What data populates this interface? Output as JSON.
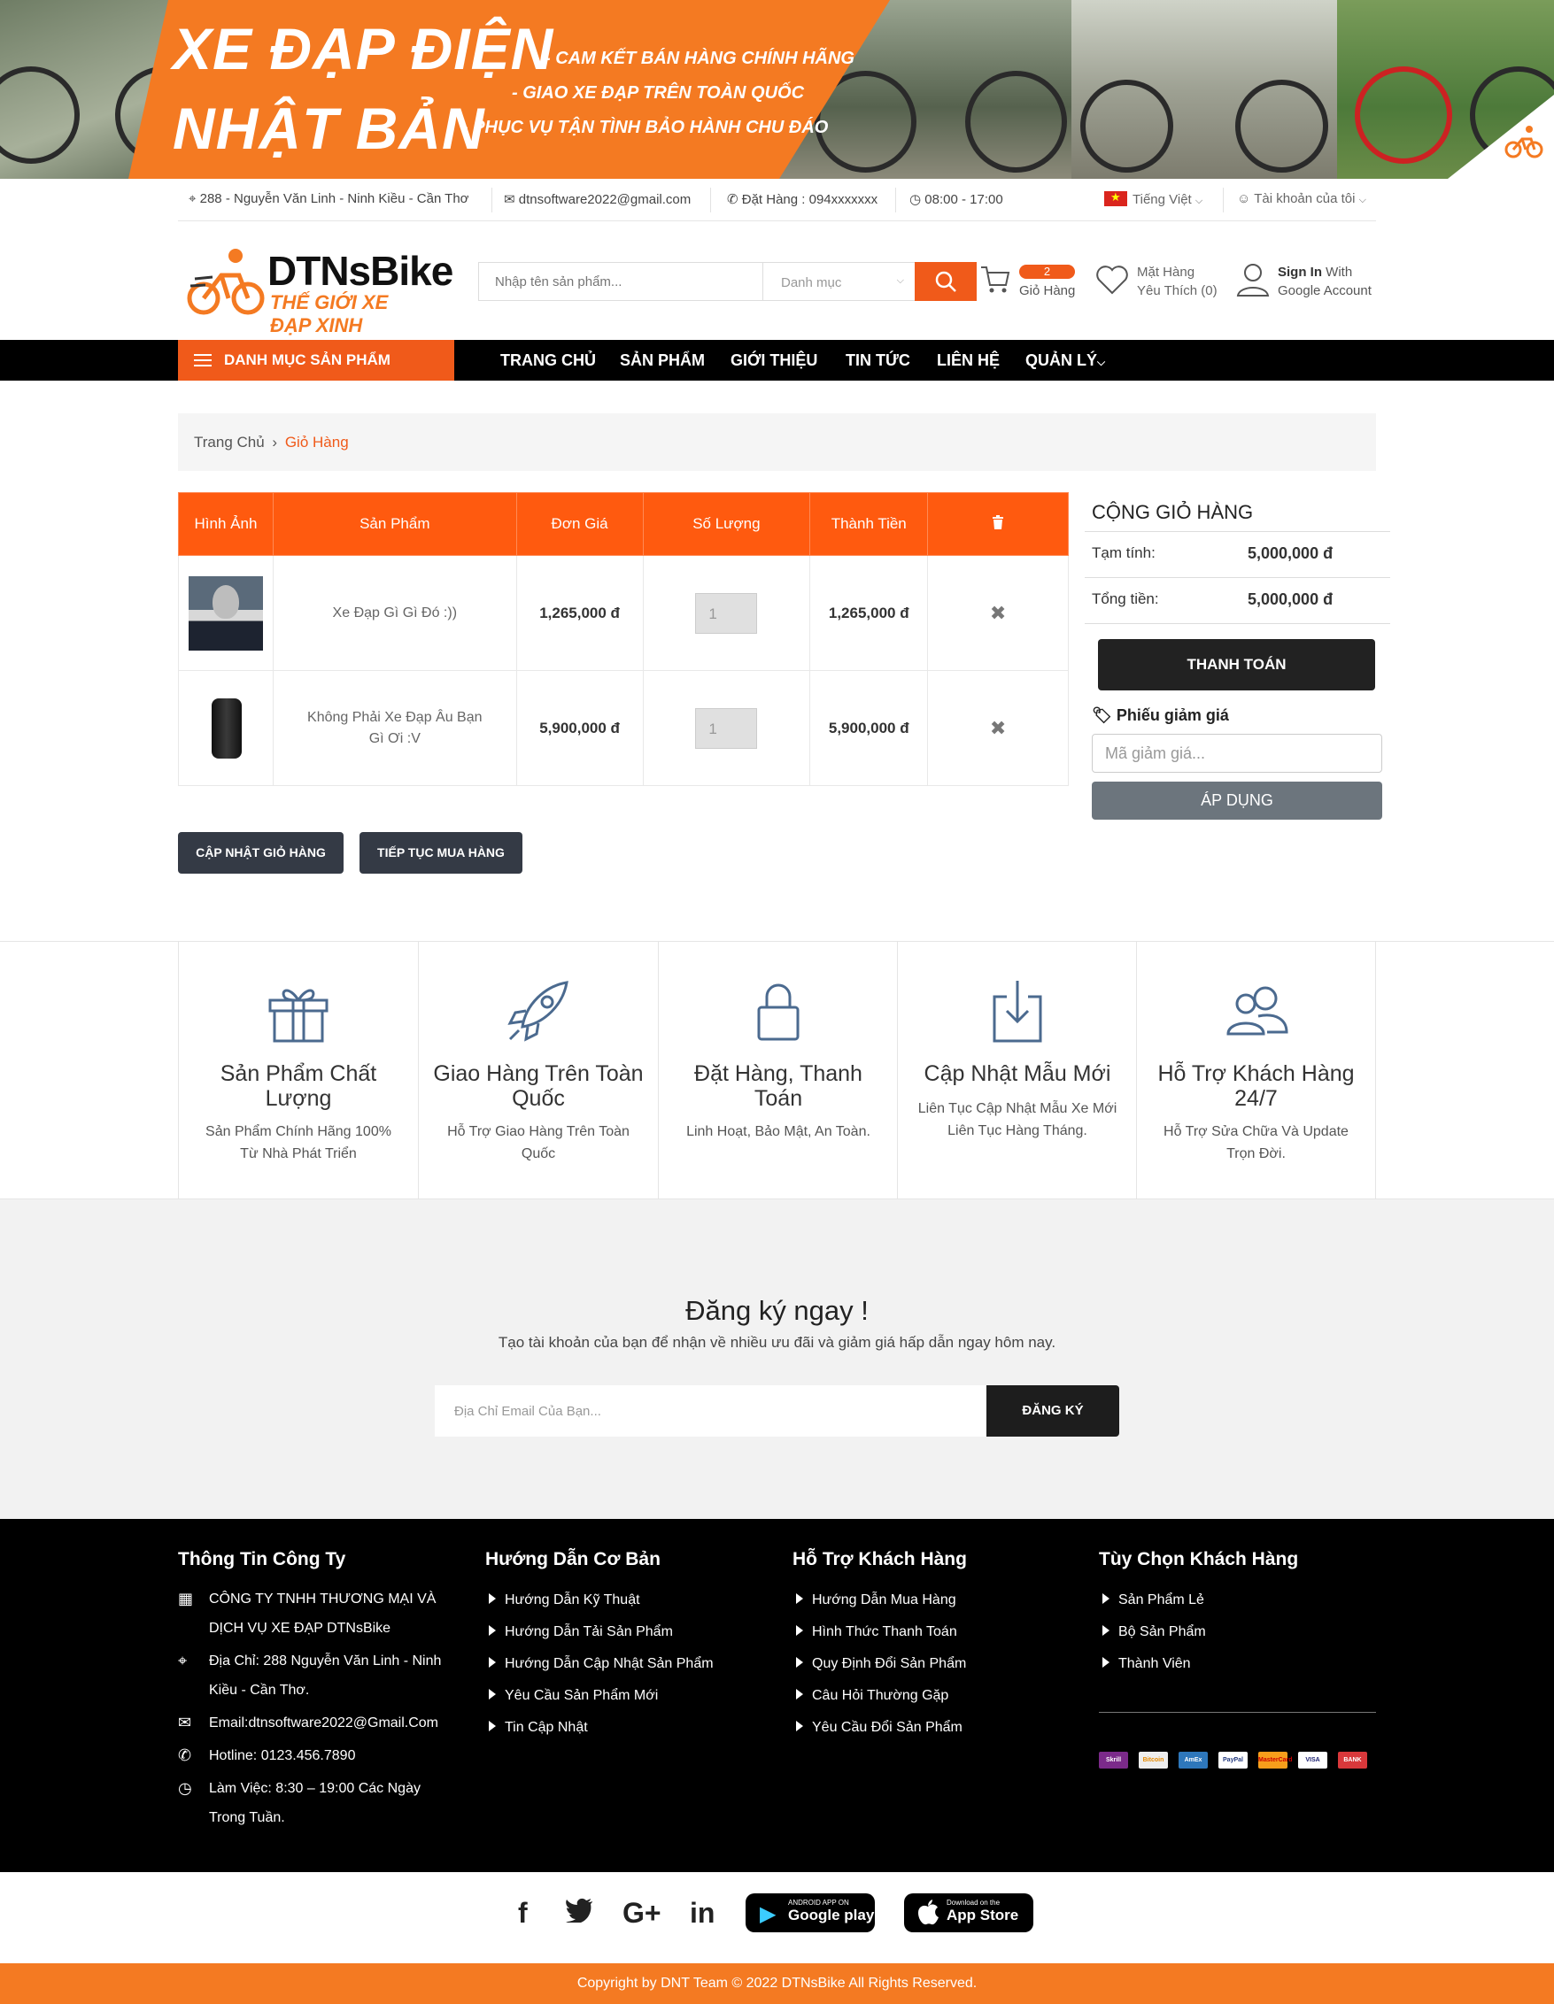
{
  "banner": {
    "title_line1": "XE ĐẠP ĐIỆN",
    "title_line2": "NHẬT BẢN",
    "bullet1": "- CAM KẾT BÁN HÀNG CHÍNH HÃNG",
    "bullet2": "- GIAO XE ĐẠP TRÊN TOÀN QUỐC",
    "bullet3": "- PHỤC VỤ TẬN TÌNH BẢO HÀNH CHU ĐÁO"
  },
  "topbar": {
    "address": "288 - Nguyễn Văn Linh - Ninh Kiều - Cần Thơ",
    "email": "dtnsoftware2022@gmail.com",
    "phone": "Đặt Hàng : 094xxxxxxx",
    "hours": "08:00 - 17:00",
    "language": "Tiếng Việt",
    "account": "Tài khoản của tôi"
  },
  "header": {
    "logo_name": "DTNsBike",
    "logo_tagline": "THẾ GIỚI XE ĐẠP XINH",
    "search_placeholder": "Nhập tên sản phẩm...",
    "category_select": "Danh mục",
    "cart_count": "2",
    "cart_label": "Giỏ Hàng",
    "wishlist_line1": "Mặt Hàng",
    "wishlist_line2": "Yêu Thích (0)",
    "signin_bold": "Sign In",
    "signin_rest": " With",
    "signin_line2": "Google Account"
  },
  "nav": {
    "category_button": "DANH MỤC SẢN PHẨM",
    "items": [
      "TRANG CHỦ",
      "SẢN PHẨM",
      "GIỚI THIỆU",
      "TIN TỨC",
      "LIÊN HỆ",
      "QUẢN LÝ"
    ]
  },
  "breadcrumb": {
    "home": "Trang Chủ",
    "current": "Giỏ Hàng"
  },
  "cart_table": {
    "headers": [
      "Hình Ảnh",
      "Sản Phẩm",
      "Đơn Giá",
      "Số Lượng",
      "Thành Tiền"
    ],
    "rows": [
      {
        "name": "Xe Đạp Gì Gì Đó :))",
        "price": "1,265,000 đ",
        "qty": "1",
        "total": "1,265,000 đ"
      },
      {
        "name": "Không Phải Xe Đạp Âu Bạn Gì Ơi :V",
        "price": "5,900,000 đ",
        "qty": "1",
        "total": "5,900,000 đ"
      }
    ]
  },
  "cart_actions": {
    "update": "CẬP NHẬT GIỎ HÀNG",
    "continue": "TIẾP TỤC MUA HÀNG"
  },
  "totals": {
    "title": "CỘNG GIỎ HÀNG",
    "subtotal_label": "Tạm tính:",
    "subtotal_value": "5,000,000 đ",
    "total_label": "Tổng tiền:",
    "total_value": "5,000,000 đ",
    "checkout": "THANH TOÁN",
    "coupon_label": "Phiếu giảm giá",
    "coupon_placeholder": "Mã giảm giá...",
    "apply": "ÁP DỤNG"
  },
  "features": [
    {
      "icon": "gift-icon",
      "title": "Sản Phẩm Chất Lượng",
      "desc": "Sản Phẩm Chính Hãng 100% Từ Nhà Phát Triển"
    },
    {
      "icon": "rocket-icon",
      "title": "Giao Hàng Trên Toàn Quốc",
      "desc": "Hỗ Trợ Giao Hàng Trên Toàn Quốc"
    },
    {
      "icon": "lock-icon",
      "title": "Đặt Hàng, Thanh Toán",
      "desc": "Linh Hoạt, Bảo Mật, An Toàn."
    },
    {
      "icon": "download-icon",
      "title": "Cập Nhật Mẫu Mới",
      "desc": "Liên Tục Cập Nhật Mẫu Xe Mới Liên Tục Hàng Tháng."
    },
    {
      "icon": "users-icon",
      "title": "Hỗ Trợ Khách Hàng 24/7",
      "desc": "Hỗ Trợ Sửa Chữa Và Update Trọn Đời."
    }
  ],
  "subscribe": {
    "title": "Đăng ký ngay !",
    "desc": "Tạo tài khoản của bạn để nhận về nhiều ưu đãi và giảm giá hấp dẫn ngay hôm nay.",
    "placeholder": "Địa Chỉ Email Của Bạn...",
    "button": "ĐĂNG KÝ"
  },
  "footer": {
    "company": {
      "heading": "Thông Tin Công Ty",
      "name_line1": "CÔNG TY TNHH THƯƠNG MẠI VÀ",
      "name_line2": "DỊCH VỤ XE ĐẠP DTNsBike",
      "address_line1": "Địa Chỉ: 288 Nguyễn Văn Linh - Ninh",
      "address_line2": "Kiều - Cần Thơ.",
      "email": "Email:dtnsoftware2022@Gmail.Com",
      "hotline": "Hotline: 0123.456.7890",
      "hours_line1": "Làm Việc: 8:30 – 19:00 Các Ngày",
      "hours_line2": "Trong Tuần."
    },
    "guide": {
      "heading": "Hướng Dẫn Cơ Bản",
      "items": [
        "Hướng Dẫn Kỹ Thuật",
        "Hướng Dẫn Tải Sản Phẩm",
        "Hướng Dẫn Cập Nhật Sản Phẩm",
        "Yêu Cầu Sản Phẩm Mới",
        "Tin Cập Nhật"
      ]
    },
    "support": {
      "heading": "Hỗ Trợ Khách Hàng",
      "items": [
        "Hướng Dẫn Mua Hàng",
        "Hình Thức Thanh Toán",
        "Quy Định Đổi Sản Phẩm",
        "Câu Hỏi Thường Gặp",
        "Yêu Cầu Đổi Sản Phẩm"
      ]
    },
    "options": {
      "heading": "Tùy Chọn Khách Hàng",
      "items": [
        "Sản Phẩm Lẻ",
        "Bộ Sản Phẩm",
        "Thành Viên"
      ]
    },
    "payments": [
      "Skrill",
      "Bitcoin",
      "AmEx",
      "PayPal",
      "MasterCard",
      "VISA",
      "BANK"
    ]
  },
  "social": {
    "icons": [
      "facebook-icon",
      "twitter-icon",
      "google-plus-icon",
      "linkedin-icon"
    ],
    "google_play_small": "ANDROID APP ON",
    "google_play": "Google play",
    "app_store_small": "Download on the",
    "app_store": "App Store"
  },
  "copyright": "Copyright by DNT Team © 2022 DTNsBike All Rights Reserved.",
  "colors": {
    "accent": "#f05a1a",
    "banner_orange": "#f47a22",
    "dark": "#343a45"
  }
}
